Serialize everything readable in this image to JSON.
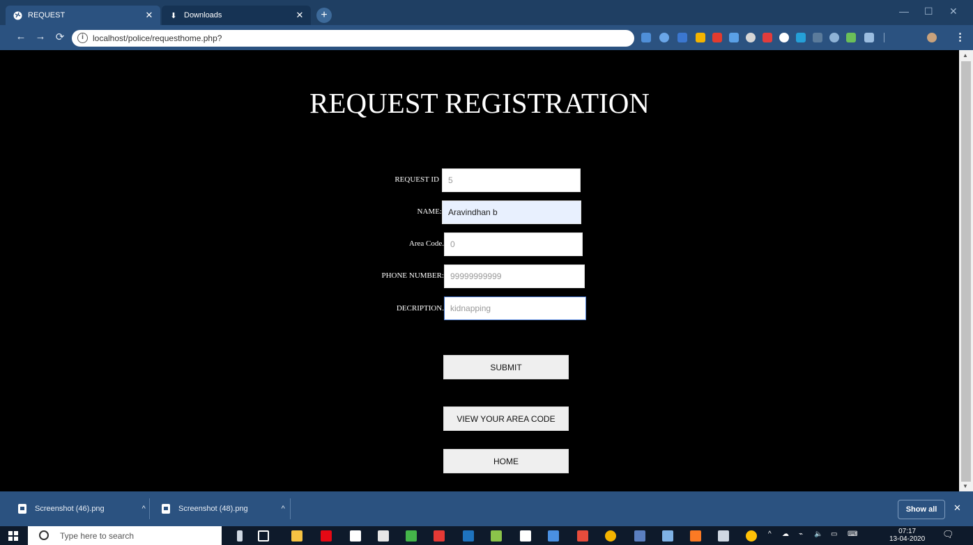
{
  "browser": {
    "tabs": [
      {
        "title": "REQUEST",
        "active": true
      },
      {
        "title": "Downloads",
        "active": false
      }
    ],
    "url": "localhost/police/requesthome.php?",
    "colors": {
      "tabbar": "#1f3f63",
      "toolbar": "#2b5280"
    }
  },
  "page": {
    "title": "REQUEST REGISTRATION",
    "fields": {
      "request_id": {
        "label": "REQUEST ID",
        "value": "5"
      },
      "name": {
        "label": "NAME:",
        "value": "Aravindhan b"
      },
      "area_code": {
        "label": "Area Code.",
        "value": "0"
      },
      "phone": {
        "label": "PHONE NUMBER:",
        "value": "99999999999"
      },
      "description": {
        "label": "DECRIPTION.",
        "value": "kidnapping"
      }
    },
    "buttons": {
      "submit": "SUBMIT",
      "view_area": "VIEW YOUR AREA CODE",
      "home": "HOME"
    }
  },
  "downloads": {
    "items": [
      {
        "name": "Screenshot (46).png"
      },
      {
        "name": "Screenshot (48).png"
      }
    ],
    "show_all": "Show all"
  },
  "taskbar": {
    "search_placeholder": "Type here to search",
    "time": "07:17",
    "date": "13-04-2020"
  }
}
